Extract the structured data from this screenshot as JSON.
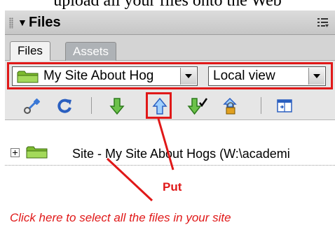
{
  "caption": "upload all your files onto the Web",
  "panel": {
    "title": "Files",
    "collapse_glyph": "▼",
    "options_icon": "options-menu-icon"
  },
  "tabs": [
    {
      "label": "Files",
      "active": true
    },
    {
      "label": "Assets",
      "active": false
    }
  ],
  "site_selector": {
    "value": "My Site About Hog",
    "icon": "folder-icon"
  },
  "view_selector": {
    "value": "Local view"
  },
  "toolbar": {
    "buttons": [
      {
        "name": "connect",
        "icon": "connect-plug-icon"
      },
      {
        "name": "refresh",
        "icon": "refresh-icon"
      },
      {
        "name": "get",
        "icon": "down-arrow-icon"
      },
      {
        "name": "put",
        "icon": "up-arrow-icon"
      },
      {
        "name": "check-out",
        "icon": "check-out-icon"
      },
      {
        "name": "check-in",
        "icon": "check-in-lock-icon"
      },
      {
        "name": "expand",
        "icon": "expand-panel-icon"
      }
    ]
  },
  "tree": {
    "root_label": "Site - My Site About Hogs (W:\\academi"
  },
  "annotations": {
    "put_label": "Put",
    "click_label": "Click here to select all the files in your site"
  },
  "colors": {
    "highlight": "#e01818",
    "panel_header": "#c6c6c6",
    "tab_inactive": "#aeb2b6",
    "folder": "#8cc63f",
    "arrow_green": "#3c9a2c",
    "arrow_blue": "#3a78d6"
  }
}
